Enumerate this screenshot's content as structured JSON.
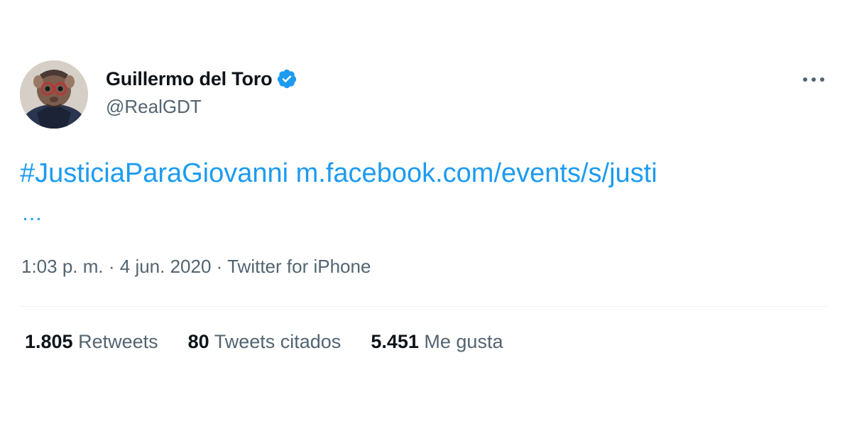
{
  "author": {
    "name": "Guillermo del Toro",
    "handle": "@RealGDT",
    "verified": true,
    "avatar_icon": "profile-photo"
  },
  "tweet": {
    "hashtag": "#JusticiaParaGiovanni",
    "link_text": "m.facebook.com/events/s/justi",
    "truncation": "…",
    "time": "1:03 p. m.",
    "date": "4 jun. 2020",
    "source": "Twitter for iPhone",
    "separator": "·"
  },
  "stats": [
    {
      "value": "1.805",
      "label": "Retweets"
    },
    {
      "value": "80",
      "label": "Tweets citados"
    },
    {
      "value": "5.451",
      "label": "Me gusta"
    }
  ],
  "colors": {
    "link": "#1d9bf0",
    "secondary_text": "#536471",
    "primary_text": "#0f1419",
    "verified_badge": "#1d9bf0"
  },
  "icons": {
    "verified": "verified-badge-icon",
    "more": "more-options-icon"
  }
}
